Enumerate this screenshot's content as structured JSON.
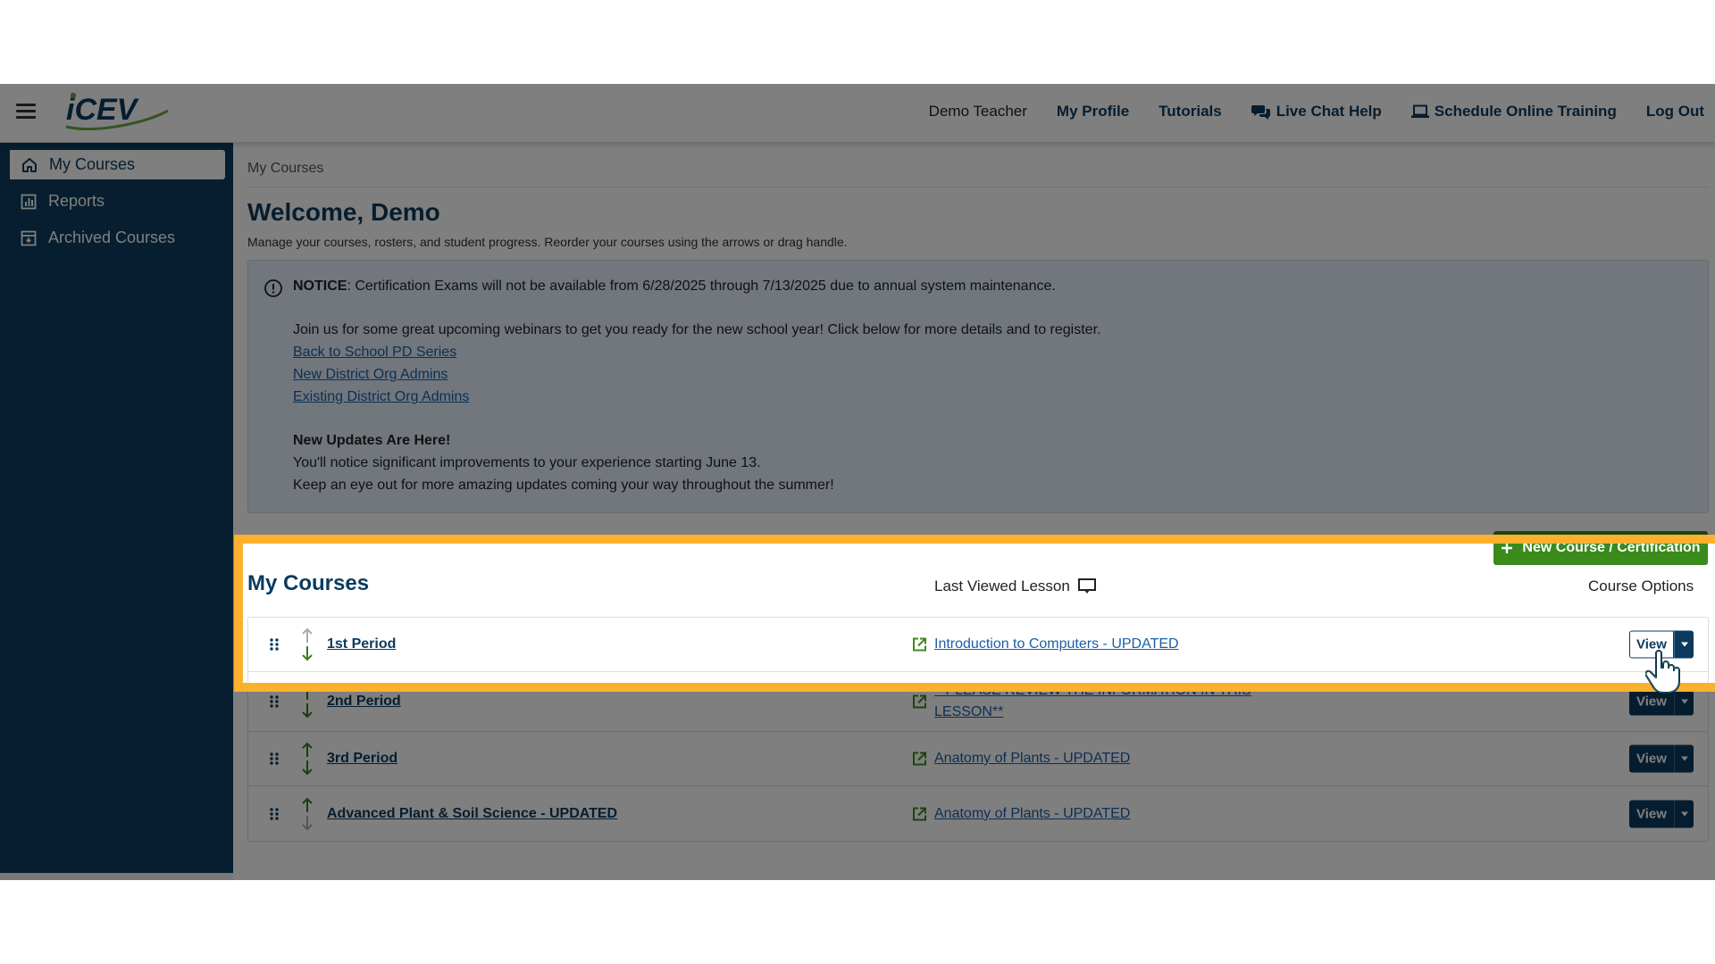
{
  "topbar": {
    "logo_text": "iCEV",
    "user_name": "Demo Teacher",
    "my_profile": "My Profile",
    "tutorials": "Tutorials",
    "live_chat": "Live Chat Help",
    "schedule_training": "Schedule Online Training",
    "log_out": "Log Out"
  },
  "sidebar": {
    "items": [
      {
        "label": "My Courses",
        "icon": "home-icon",
        "active": true
      },
      {
        "label": "Reports",
        "icon": "chart-icon",
        "active": false
      },
      {
        "label": "Archived Courses",
        "icon": "archive-icon",
        "active": false
      }
    ]
  },
  "main": {
    "breadcrumb": "My Courses",
    "welcome": "Welcome, Demo",
    "subtitle": "Manage your courses, rosters, and student progress. Reorder your courses using the arrows or drag handle.",
    "notice": {
      "label": "NOTICE",
      "text": ": Certification Exams will not be available from 6/28/2025 through 7/13/2025 due to annual system maintenance.",
      "webinar_intro": "Join us for some great upcoming webinars to get you ready for the new school year! Click below for more details and to register.",
      "links": [
        "Back to School PD Series",
        "New District Org Admins",
        "Existing District Org Admins"
      ],
      "updates_title": "New Updates Are Here!",
      "updates_line1": "You'll notice significant improvements to your experience starting June 13.",
      "updates_line2": "Keep an eye out for more amazing updates coming your way throughout the summer!"
    },
    "new_course_button": "New Course / Certification",
    "courses": {
      "title": "My Courses",
      "col_last_viewed": "Last Viewed Lesson",
      "col_options": "Course Options",
      "view_label": "View",
      "rows": [
        {
          "name": "1st Period",
          "lesson": "Introduction to Computers - UPDATED"
        },
        {
          "name": "2nd Period",
          "lesson": "**PLEASE REVIEW THE INFORMATION IN THIS LESSON**"
        },
        {
          "name": "3rd Period",
          "lesson": "Anatomy of Plants - UPDATED"
        },
        {
          "name": "Advanced Plant & Soil Science - UPDATED",
          "lesson": "Anatomy of Plants - UPDATED"
        }
      ]
    }
  },
  "colors": {
    "brand_navy": "#0c3d5e",
    "highlight": "#fbb02e",
    "success_green": "#3b8a1c",
    "link_blue": "#1a5fa8"
  }
}
